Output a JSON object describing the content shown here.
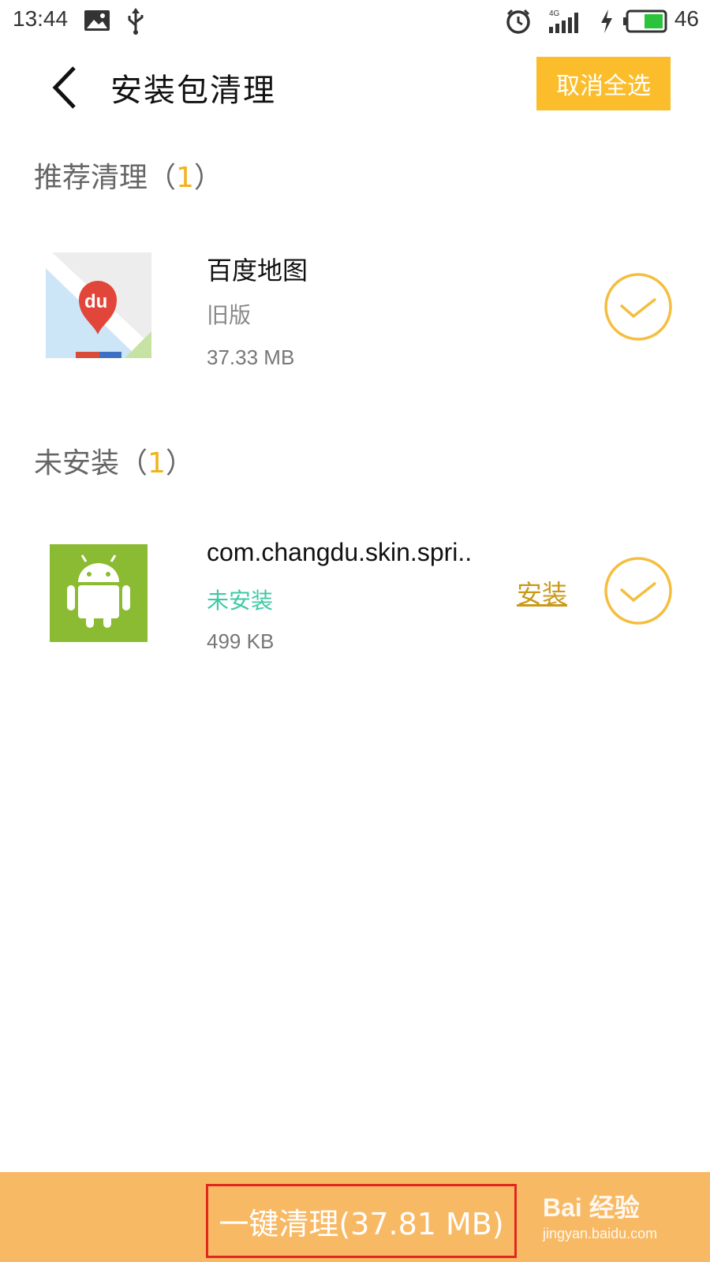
{
  "status_bar": {
    "time": "13:44",
    "network": "4G",
    "battery": "46",
    "icons": [
      "image-icon",
      "usb-icon",
      "alarm-icon",
      "signal-icon",
      "charging-icon",
      "battery-icon"
    ]
  },
  "header": {
    "back_icon": "back-arrow-icon",
    "title": "安装包清理",
    "deselect_all": "取消全选"
  },
  "sections": [
    {
      "title": "推荐清理（",
      "count": "1",
      "close": "）",
      "items": [
        {
          "icon": "baidu-map-icon",
          "name": "百度地图",
          "status": "旧版",
          "size": "37.33 MB",
          "checked": true
        }
      ]
    },
    {
      "title": "未安装（",
      "count": "1",
      "close": "）",
      "items": [
        {
          "icon": "android-icon",
          "name": "com.changdu.skin.spri..",
          "status": "未安装",
          "size": "499 KB",
          "action": "安装",
          "checked": true
        }
      ]
    }
  ],
  "bottom": {
    "clean_button": "一键清理(37.81 MB)",
    "watermark_logo": "Bai 经验",
    "watermark_url": "jingyan.baidu.com"
  },
  "colors": {
    "accent": "#fbbd2b",
    "bottom_bar": "#f8b964",
    "not_installed": "#3fc9a5",
    "highlight_box": "#e0281e"
  }
}
